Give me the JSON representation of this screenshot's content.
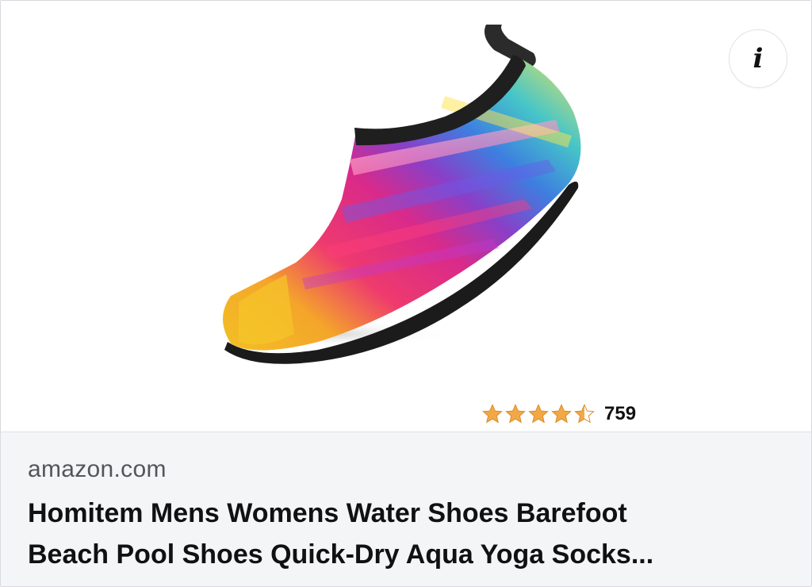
{
  "card": {
    "info_icon": "info-icon",
    "rating": {
      "value": 4.5,
      "max": 5,
      "count": "759",
      "star_color": "#f3a847"
    },
    "source": "amazon.com",
    "title_line1": "Homitem Mens Womens Water Shoes Barefoot",
    "title_line2": "Beach Pool Shoes Quick-Dry Aqua Yoga Socks..."
  }
}
